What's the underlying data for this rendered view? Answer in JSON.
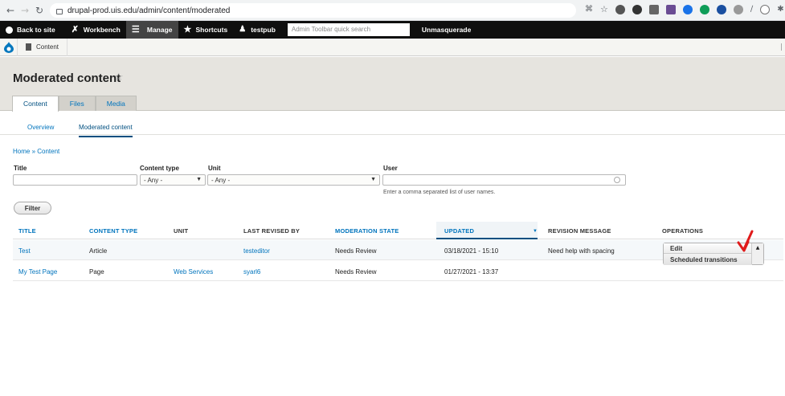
{
  "browser": {
    "url": "drupal-prod.uis.edu/admin/content/moderated"
  },
  "toolbar": {
    "back_to_site": "Back to site",
    "workbench": "Workbench",
    "manage": "Manage",
    "shortcuts": "Shortcuts",
    "user": "testpub",
    "search_placeholder": "Admin Toolbar quick search",
    "unmasquerade": "Unmasquerade"
  },
  "subbar": {
    "content": "Content"
  },
  "page": {
    "title": "Moderated content",
    "tabs": [
      "Content",
      "Files",
      "Media"
    ],
    "subtabs": [
      "Overview",
      "Moderated content"
    ],
    "breadcrumb": "Home » Content"
  },
  "filters": {
    "title_label": "Title",
    "content_type_label": "Content type",
    "content_type_value": "- Any -",
    "unit_label": "Unit",
    "unit_value": "- Any -",
    "user_label": "User",
    "user_hint": "Enter a comma separated list of user names.",
    "filter_button": "Filter"
  },
  "table": {
    "headers": {
      "title": "TITLE",
      "content_type": "CONTENT TYPE",
      "unit": "UNIT",
      "last_revised_by": "LAST REVISED BY",
      "moderation_state": "MODERATION STATE",
      "updated": "UPDATED",
      "revision_message": "REVISION MESSAGE",
      "operations": "OPERATIONS"
    },
    "rows": [
      {
        "title": "Test",
        "content_type": "Article",
        "unit": "",
        "last_revised_by": "testeditor",
        "moderation_state": "Needs Review",
        "updated": "03/18/2021 - 15:10",
        "revision_message": "Need help with spacing"
      },
      {
        "title": "My Test Page",
        "content_type": "Page",
        "unit": "Web Services",
        "last_revised_by": "syarl6",
        "moderation_state": "Needs Review",
        "updated": "01/27/2021 - 13:37",
        "revision_message": ""
      }
    ],
    "operations": {
      "edit": "Edit",
      "scheduled": "Scheduled transitions"
    }
  },
  "colors": {
    "link": "#0074bd",
    "toolbar": "#0f0f0f",
    "annotation": "#e01b1b"
  }
}
